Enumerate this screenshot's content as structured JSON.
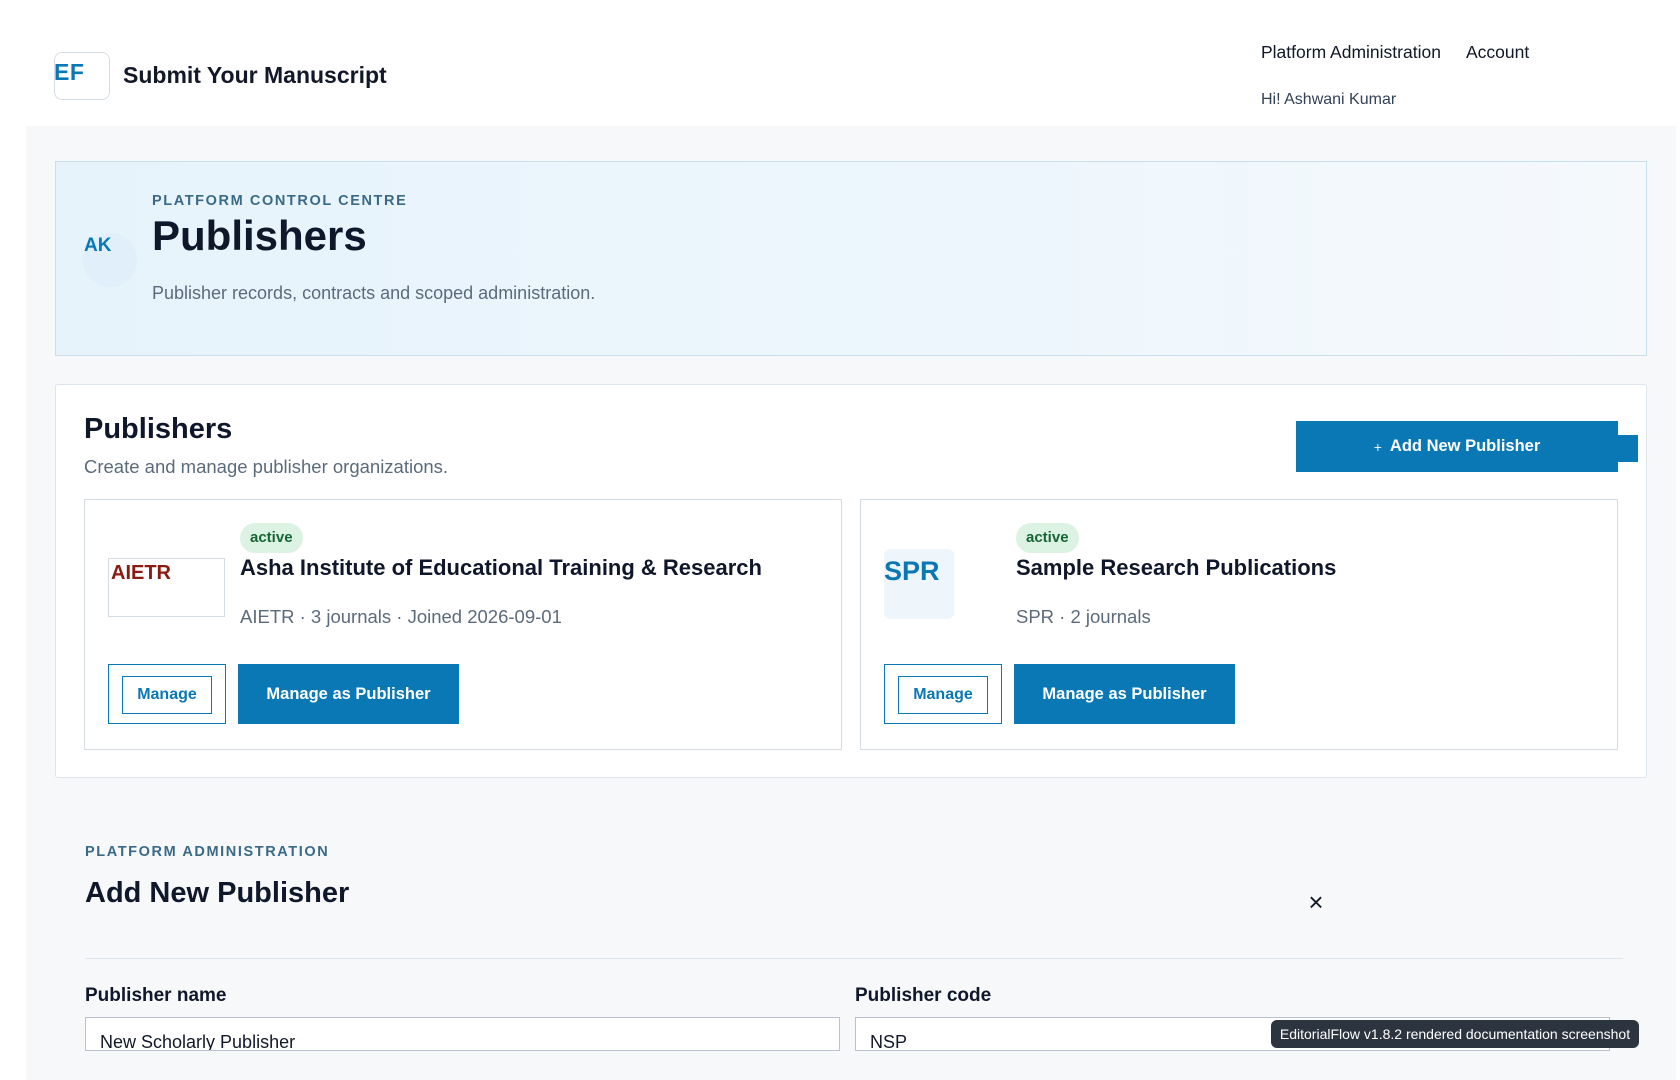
{
  "header": {
    "logo_text": "EF",
    "site_title": "Submit Your Manuscript",
    "nav": {
      "platform_admin": "Platform Administration",
      "account": "Account"
    },
    "greeting": "Hi! Ashwani Kumar"
  },
  "hero": {
    "avatar_initials": "AK",
    "eyebrow": "PLATFORM CONTROL CENTRE",
    "title": "Publishers",
    "subtitle": "Publisher records, contracts and scoped administration."
  },
  "publishers_panel": {
    "title": "Publishers",
    "subtitle": "Create and manage publisher organizations.",
    "add_button_icon": "+",
    "add_button_label": "Add New Publisher",
    "cards": [
      {
        "logo_text": "AIETR",
        "status": "active",
        "name": "Asha Institute of Educational Training & Research",
        "meta": "AIETR · 3 journals · Joined 2026-09-01",
        "manage_label": "Manage",
        "manage_as_label": "Manage as Publisher"
      },
      {
        "logo_text": "SPR",
        "status": "active",
        "name": "Sample Research Publications",
        "meta": "SPR · 2 journals",
        "manage_label": "Manage",
        "manage_as_label": "Manage as Publisher"
      }
    ]
  },
  "add_form": {
    "eyebrow": "PLATFORM ADMINISTRATION",
    "title": "Add New Publisher",
    "close_icon": "×",
    "fields": {
      "name_label": "Publisher name",
      "name_value": "New Scholarly Publisher",
      "code_label": "Publisher code",
      "code_value": "NSP"
    }
  },
  "footer": {
    "version_text": "EditorialFlow v1.8.2 rendered documentation screenshot"
  },
  "colors": {
    "accent": "#0b78b6",
    "active_badge_bg": "#dcf2e3",
    "active_badge_text": "#166534",
    "aietr_logo": "#8b1a10"
  }
}
